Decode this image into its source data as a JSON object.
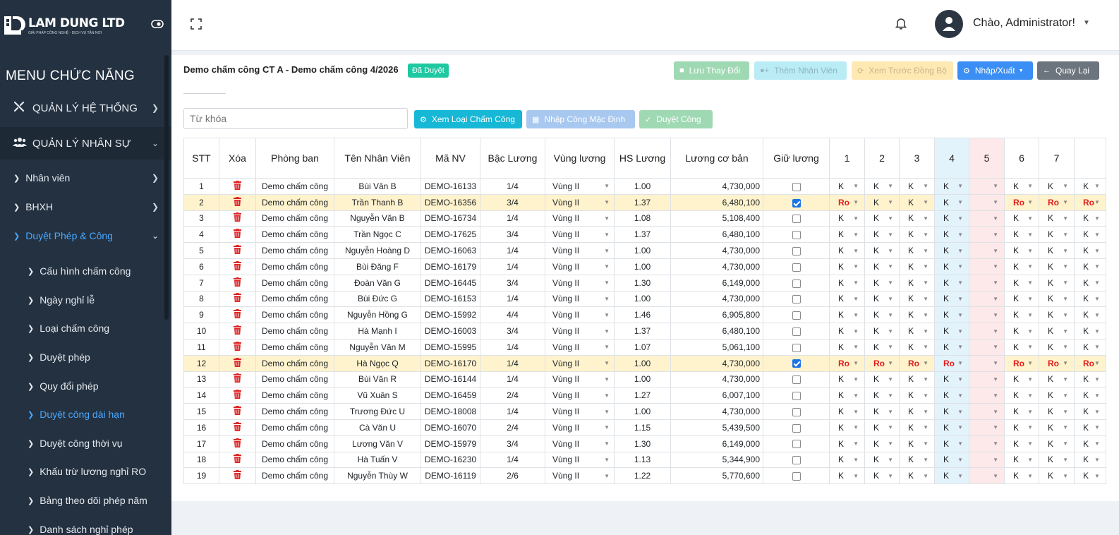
{
  "brand": {
    "name": "LAM DUNG LTD",
    "tagline": "GIẢI PHÁP CÔNG NGHỆ - DỊCH VỤ TẬN NƠI"
  },
  "sidebar": {
    "menu_title": "MENU CHỨC NĂNG",
    "system": "QUẢN LÝ HỆ THỐNG",
    "hr": "QUẢN LÝ NHÂN SỰ",
    "items": [
      {
        "label": "Nhân viên"
      },
      {
        "label": "BHXH"
      },
      {
        "label": "Duyệt Phép & Công"
      }
    ],
    "subitems": [
      {
        "label": "Cấu hình chấm công"
      },
      {
        "label": "Ngày nghỉ lễ"
      },
      {
        "label": "Loại chấm công"
      },
      {
        "label": "Duyệt phép"
      },
      {
        "label": "Quy đổi phép"
      },
      {
        "label": "Duyệt công dài hạn"
      },
      {
        "label": "Duyệt công thời vụ"
      },
      {
        "label": "Khấu trừ lương nghỉ RO"
      },
      {
        "label": "Bảng theo dõi phép năm"
      },
      {
        "label": "Danh sách nghỉ phép"
      }
    ]
  },
  "header": {
    "greeting": "Chào, Administrator!"
  },
  "page": {
    "title": "Demo chấm công CT A - Demo chấm công 4/2026",
    "status": "Đã Duyệt",
    "buttons": {
      "save": "Lưu Thay Đổi",
      "add": "Thêm Nhân Viên",
      "preview": "Xem Trước Đồng Bộ",
      "io": "Nhập/Xuất",
      "back": "Quay Lại",
      "type": "Xem Loại Chấm Công",
      "default": "Nhập Công Mặc Định",
      "approve": "Duyệt Công"
    },
    "search_placeholder": "Từ khóa"
  },
  "table": {
    "headers": [
      "STT",
      "Xóa",
      "Phòng ban",
      "Tên Nhân Viên",
      "Mã NV",
      "Bậc Lương",
      "Vùng lương",
      "HS Lương",
      "Lương cơ bản",
      "Giữ lương",
      "1",
      "2",
      "3",
      "4",
      "5",
      "6",
      "7"
    ],
    "rows": [
      {
        "stt": "1",
        "dept": "Demo chấm công",
        "name": "Bùi Văn B",
        "id": "DEMO-16133",
        "grade": "1/4",
        "zone": "Vùng II",
        "coef": "1.00",
        "salary": "4,730,000",
        "hold": false
      },
      {
        "stt": "2",
        "dept": "Demo chấm công",
        "name": "Trần Thanh B",
        "id": "DEMO-16356",
        "grade": "3/4",
        "zone": "Vùng II",
        "coef": "1.37",
        "salary": "6,480,100",
        "hold": true
      },
      {
        "stt": "3",
        "dept": "Demo chấm công",
        "name": "Nguyễn Văn B",
        "id": "DEMO-16734",
        "grade": "1/4",
        "zone": "Vùng II",
        "coef": "1.08",
        "salary": "5,108,400",
        "hold": false
      },
      {
        "stt": "4",
        "dept": "Demo chấm công",
        "name": "Trần Ngọc C",
        "id": "DEMO-17625",
        "grade": "3/4",
        "zone": "Vùng II",
        "coef": "1.37",
        "salary": "6,480,100",
        "hold": false
      },
      {
        "stt": "5",
        "dept": "Demo chấm công",
        "name": "Nguyễn Hoàng D",
        "id": "DEMO-16063",
        "grade": "1/4",
        "zone": "Vùng II",
        "coef": "1.00",
        "salary": "4,730,000",
        "hold": false
      },
      {
        "stt": "6",
        "dept": "Demo chấm công",
        "name": "Bùi Đăng F",
        "id": "DEMO-16179",
        "grade": "1/4",
        "zone": "Vùng II",
        "coef": "1.00",
        "salary": "4,730,000",
        "hold": false
      },
      {
        "stt": "7",
        "dept": "Demo chấm công",
        "name": "Đoàn Văn G",
        "id": "DEMO-16445",
        "grade": "3/4",
        "zone": "Vùng II",
        "coef": "1.30",
        "salary": "6,149,000",
        "hold": false
      },
      {
        "stt": "8",
        "dept": "Demo chấm công",
        "name": "Bùi Đức G",
        "id": "DEMO-16153",
        "grade": "1/4",
        "zone": "Vùng II",
        "coef": "1.00",
        "salary": "4,730,000",
        "hold": false
      },
      {
        "stt": "9",
        "dept": "Demo chấm công",
        "name": "Nguyễn Hồng G",
        "id": "DEMO-15992",
        "grade": "4/4",
        "zone": "Vùng II",
        "coef": "1.46",
        "salary": "6,905,800",
        "hold": false
      },
      {
        "stt": "10",
        "dept": "Demo chấm công",
        "name": "Hà Mạnh I",
        "id": "DEMO-16003",
        "grade": "3/4",
        "zone": "Vùng II",
        "coef": "1.37",
        "salary": "6,480,100",
        "hold": false
      },
      {
        "stt": "11",
        "dept": "Demo chấm công",
        "name": "Nguyễn Văn M",
        "id": "DEMO-15995",
        "grade": "1/4",
        "zone": "Vùng II",
        "coef": "1.07",
        "salary": "5,061,100",
        "hold": false
      },
      {
        "stt": "12",
        "dept": "Demo chấm công",
        "name": "Hà Ngọc Q",
        "id": "DEMO-16170",
        "grade": "1/4",
        "zone": "Vùng II",
        "coef": "1.00",
        "salary": "4,730,000",
        "hold": true
      },
      {
        "stt": "13",
        "dept": "Demo chấm công",
        "name": "Bùi Văn R",
        "id": "DEMO-16144",
        "grade": "1/4",
        "zone": "Vùng II",
        "coef": "1.00",
        "salary": "4,730,000",
        "hold": false
      },
      {
        "stt": "14",
        "dept": "Demo chấm công",
        "name": "Vũ Xuân S",
        "id": "DEMO-16459",
        "grade": "2/4",
        "zone": "Vùng II",
        "coef": "1.27",
        "salary": "6,007,100",
        "hold": false
      },
      {
        "stt": "15",
        "dept": "Demo chấm công",
        "name": "Trương Đức U",
        "id": "DEMO-18008",
        "grade": "1/4",
        "zone": "Vùng II",
        "coef": "1.00",
        "salary": "4,730,000",
        "hold": false
      },
      {
        "stt": "16",
        "dept": "Demo chấm công",
        "name": "Cà Văn U",
        "id": "DEMO-16070",
        "grade": "2/4",
        "zone": "Vùng II",
        "coef": "1.15",
        "salary": "5,439,500",
        "hold": false
      },
      {
        "stt": "17",
        "dept": "Demo chấm công",
        "name": "Lương Văn V",
        "id": "DEMO-15979",
        "grade": "3/4",
        "zone": "Vùng II",
        "coef": "1.30",
        "salary": "6,149,000",
        "hold": false
      },
      {
        "stt": "18",
        "dept": "Demo chấm công",
        "name": "Hà Tuấn V",
        "id": "DEMO-16230",
        "grade": "1/4",
        "zone": "Vùng II",
        "coef": "1.13",
        "salary": "5,344,900",
        "hold": false
      },
      {
        "stt": "19",
        "dept": "Demo chấm công",
        "name": "Nguyễn Thùy W",
        "id": "DEMO-16119",
        "grade": "2/6",
        "zone": "Vùng II",
        "coef": "1.22",
        "salary": "5,770,600",
        "hold": false
      }
    ],
    "day_values": {
      "normal": [
        "K",
        "K",
        "K",
        "K",
        "",
        "K",
        "K",
        "K"
      ],
      "row2": [
        "Ro",
        "K",
        "K",
        "K",
        "",
        "Ro",
        "Ro",
        "Ro"
      ],
      "row12": [
        "Ro",
        "Ro",
        "Ro",
        "Ro",
        "",
        "Ro",
        "Ro",
        "Ro"
      ]
    }
  },
  "colors": {
    "sidebar": "#233140",
    "accent": "#4aa8ff",
    "danger": "#e02424",
    "highlight": "#fff3cd"
  }
}
